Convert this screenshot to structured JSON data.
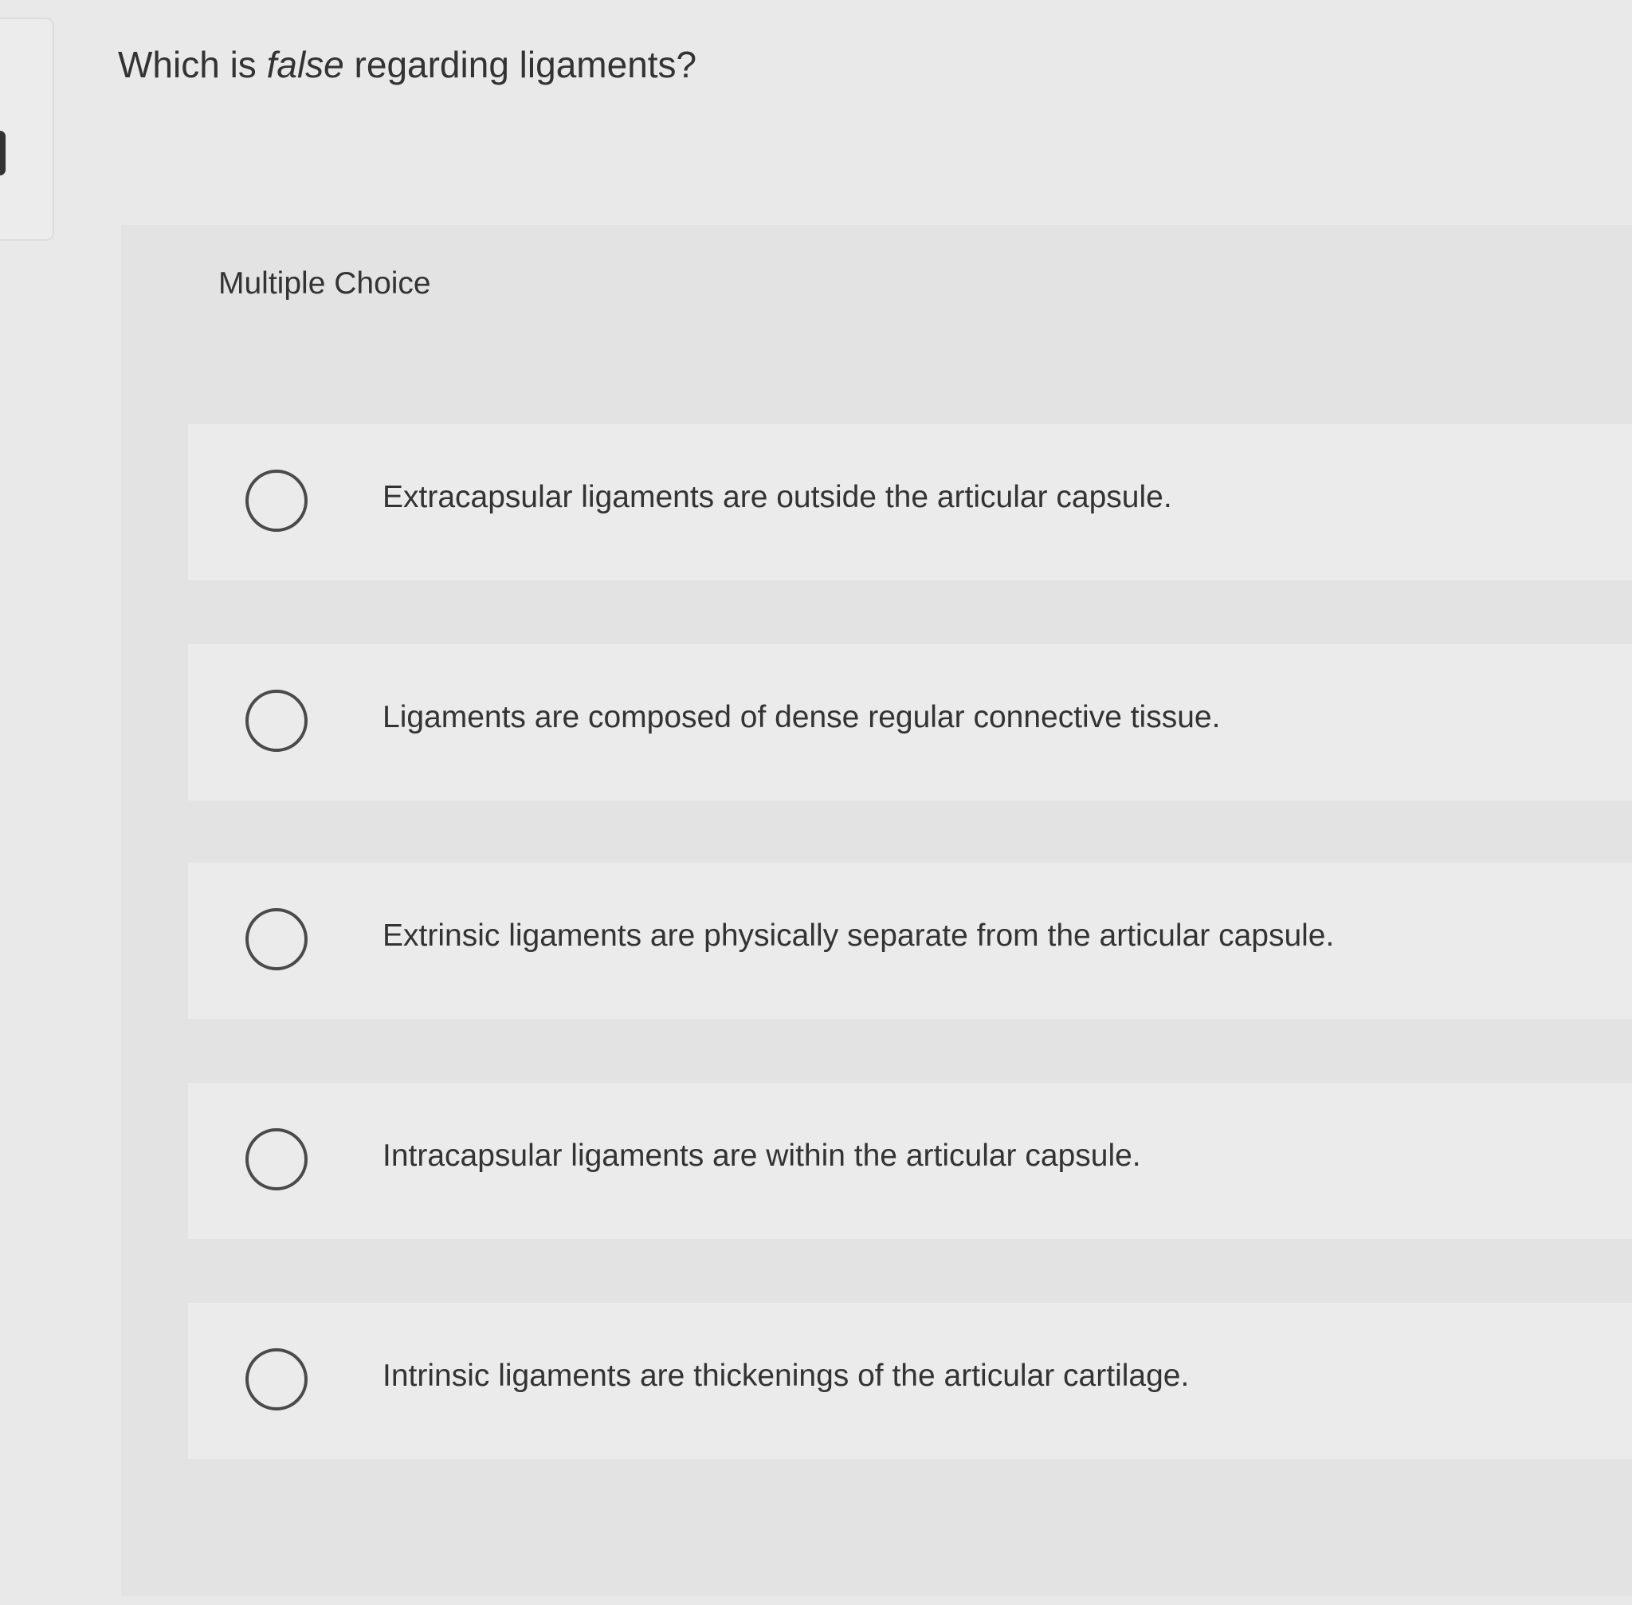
{
  "question": {
    "prefix": "Which is ",
    "emphasis": "false",
    "suffix": " regarding ligaments?"
  },
  "multiple_choice_label": "Multiple Choice",
  "options": [
    "Extracapsular ligaments are outside the articular capsule.",
    "Ligaments are composed of dense regular connective tissue.",
    "Extrinsic ligaments are physically separate from the articular capsule.",
    "Intracapsular ligaments are within the articular capsule.",
    "Intrinsic ligaments are thickenings of the articular cartilage."
  ],
  "colors": {
    "background": "#e9e9e9",
    "panel": "#e3e3e3",
    "option_row": "#ebebeb",
    "text": "#333333",
    "radio_border": "#4a4a4a"
  }
}
